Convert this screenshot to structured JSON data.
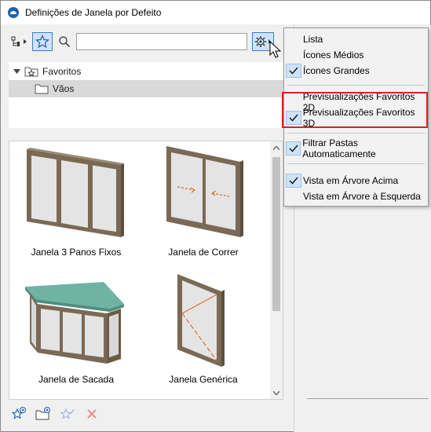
{
  "window": {
    "title": "Definições de Janela por Defeito"
  },
  "toolbar": {
    "search_value": "",
    "icons": {
      "tree": "tree-view-icon",
      "favorites": "star-icon",
      "search": "magnifier-icon",
      "settings": "gear-icon"
    }
  },
  "tree": {
    "favorites_label": "Favoritos",
    "folder_label": "Vãos"
  },
  "items": [
    {
      "label": "Janela 3 Panos Fixos",
      "icon": "window-3-fixed-panes"
    },
    {
      "label": "Janela de Correr",
      "icon": "sliding-window"
    },
    {
      "label": "Janela de Sacada",
      "icon": "bay-window"
    },
    {
      "label": "Janela Genérica",
      "icon": "generic-window"
    }
  ],
  "bottom_bar": {
    "icons": [
      "add-favorite-icon",
      "new-folder-icon",
      "rename-favorite-icon",
      "delete-icon"
    ]
  },
  "menu": {
    "group1": [
      {
        "label": "Lista",
        "checked": false
      },
      {
        "label": "Ícones Médios",
        "checked": false
      },
      {
        "label": "Ícones Grandes",
        "checked": true
      }
    ],
    "group2": [
      {
        "label": "Previsualizações Favoritos 2D",
        "checked": false
      },
      {
        "label": "Previsualizações Favoritos 3D",
        "checked": true
      }
    ],
    "group3": [
      {
        "label": "Filtrar Pastas Automaticamente",
        "checked": true
      }
    ],
    "group4": [
      {
        "label": "Vista em Árvore Acima",
        "checked": true
      },
      {
        "label": "Vista em Árvore à Esquerda",
        "checked": false
      }
    ]
  },
  "colors": {
    "accent": "#3b7ed0",
    "selected_bg": "#cfe3fb",
    "highlight_border": "#e02020",
    "frame_wood": "#7a6a55",
    "glass": "#e4e4e4",
    "roof": "#6fb3a4"
  }
}
